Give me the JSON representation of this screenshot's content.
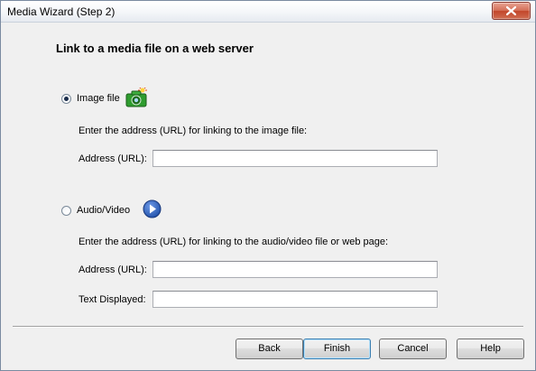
{
  "window": {
    "title": "Media Wizard (Step 2)"
  },
  "heading": "Link to a media file on a web server",
  "image_option": {
    "label": "Image file",
    "selected": true,
    "icon": "camera-icon",
    "instruction": "Enter the address (URL) for linking to the image file:",
    "address_label": "Address (URL):",
    "address_value": ""
  },
  "av_option": {
    "label": "Audio/Video",
    "selected": false,
    "icon": "play-icon",
    "instruction": "Enter the address (URL) for linking to the audio/video file or web page:",
    "address_label": "Address (URL):",
    "address_value": "",
    "text_label": "Text Displayed:",
    "text_value": ""
  },
  "buttons": {
    "back": "Back",
    "finish": "Finish",
    "cancel": "Cancel",
    "help": "Help"
  },
  "colors": {
    "close_button": "#c7472d",
    "play_button": "#1f4fa8",
    "camera_body": "#2e9c2e"
  }
}
